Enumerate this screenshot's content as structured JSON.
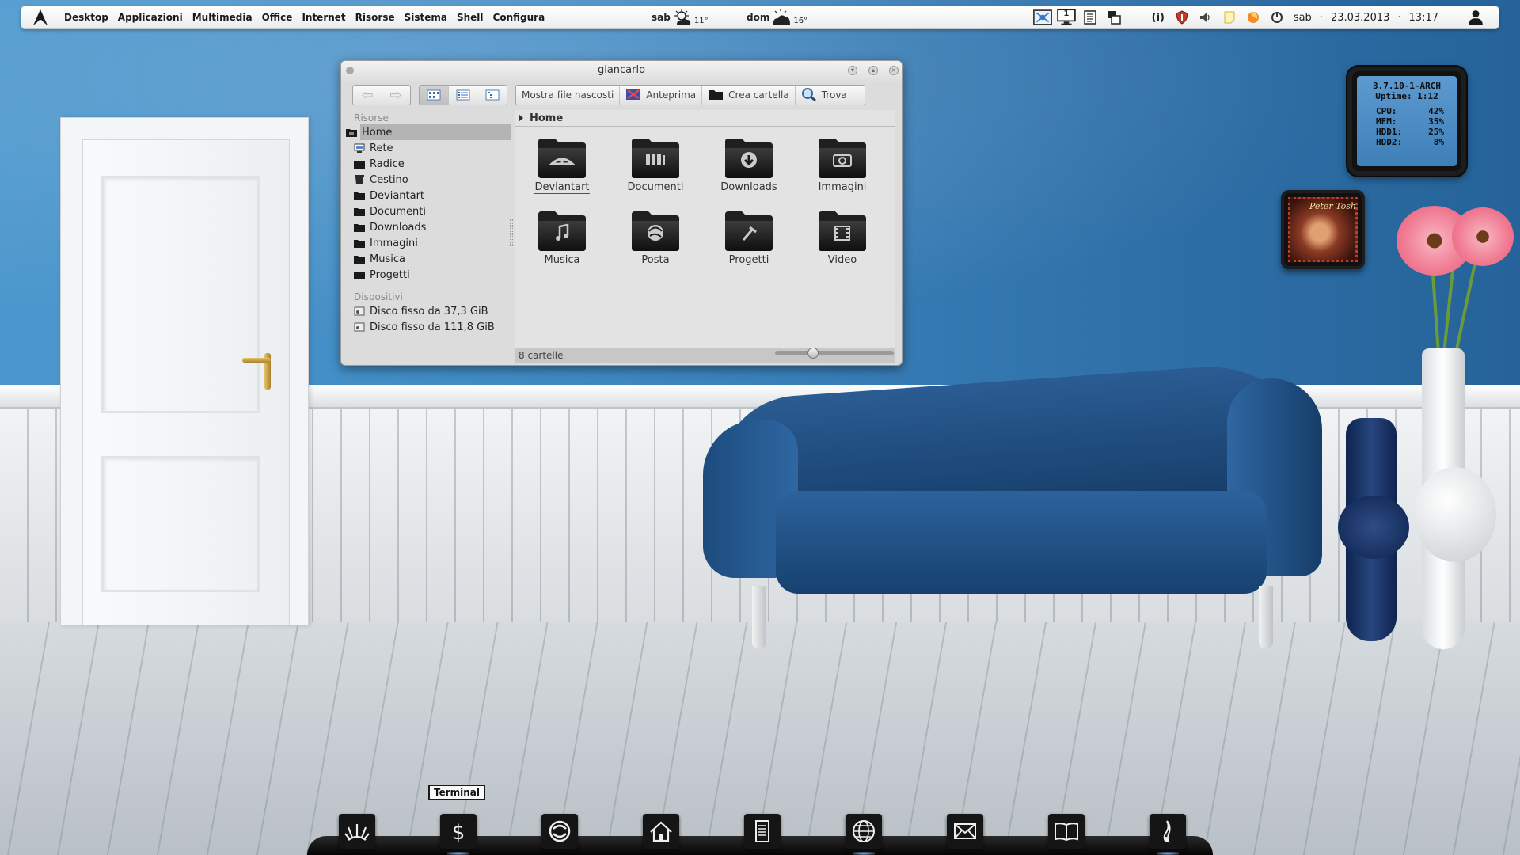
{
  "top_panel": {
    "launcher_icon": "arch-logo-icon",
    "menu": [
      "Desktop",
      "Applicazioni",
      "Multimedia",
      "Office",
      "Internet",
      "Risorse",
      "Sistema",
      "Shell",
      "Configura"
    ],
    "weather": [
      {
        "day": "sab",
        "temp": "11°",
        "icon": "partly-cloudy-icon"
      },
      {
        "day": "dom",
        "temp": "16°",
        "icon": "cloudy-icon"
      }
    ],
    "tray_icons": [
      "screenshot-icon",
      "workspace-icon",
      "clipboard-icon",
      "windows-icon",
      "info-icon",
      "shield-icon",
      "volume-icon",
      "note-icon",
      "firefox-icon",
      "power-icon"
    ],
    "tray_workspace_number": "1",
    "tray_info_label": "(i)",
    "clock_day": "sab",
    "separator": "·",
    "clock_date": "23.03.2013",
    "clock_time": "13:17",
    "user_icon": "user-icon"
  },
  "file_manager": {
    "title": "giancarlo",
    "toolbar": {
      "back_icon": "back-arrow-icon",
      "forward_icon": "forward-arrow-icon",
      "view_modes": [
        "icon-view-icon",
        "list-view-icon",
        "tree-view-icon"
      ],
      "show_hidden": "Mostra file nascosti",
      "preview": "Anteprima",
      "create_folder": "Crea cartella",
      "find": "Trova"
    },
    "sidebar": {
      "resources_header": "Risorse",
      "resources": [
        {
          "label": "Home",
          "icon": "home-folder-icon",
          "active": true
        },
        {
          "label": "Rete",
          "icon": "network-icon"
        },
        {
          "label": "Radice",
          "icon": "folder-icon"
        },
        {
          "label": "Cestino",
          "icon": "trash-icon"
        },
        {
          "label": "Deviantart",
          "icon": "folder-icon"
        },
        {
          "label": "Documenti",
          "icon": "folder-icon"
        },
        {
          "label": "Downloads",
          "icon": "folder-icon"
        },
        {
          "label": "Immagini",
          "icon": "folder-icon"
        },
        {
          "label": "Musica",
          "icon": "folder-icon"
        },
        {
          "label": "Progetti",
          "icon": "folder-icon"
        }
      ],
      "devices_header": "Dispositivi",
      "devices": [
        {
          "label": "Disco fisso da 37,3 GiB",
          "icon": "hard-disk-icon"
        },
        {
          "label": "Disco fisso da 111,8 GiB",
          "icon": "hard-disk-icon"
        }
      ]
    },
    "breadcrumb": "Home",
    "folders": [
      {
        "label": "Deviantart",
        "icon": "deviantart-folder-icon",
        "selected": true
      },
      {
        "label": "Documenti",
        "icon": "documents-folder-icon"
      },
      {
        "label": "Downloads",
        "icon": "downloads-folder-icon"
      },
      {
        "label": "Immagini",
        "icon": "pictures-folder-icon"
      },
      {
        "label": "Musica",
        "icon": "music-folder-icon"
      },
      {
        "label": "Posta",
        "icon": "mail-folder-icon"
      },
      {
        "label": "Progetti",
        "icon": "projects-folder-icon"
      },
      {
        "label": "Video",
        "icon": "video-folder-icon"
      }
    ],
    "status": "8 cartelle",
    "zoom_level": 0.3
  },
  "sysmon": {
    "kernel": "3.7.10-1-ARCH",
    "uptime_label": "Uptime:",
    "uptime": "1:12",
    "rows": [
      {
        "label": "CPU:",
        "value": "42%"
      },
      {
        "label": "MEM:",
        "value": "35%"
      },
      {
        "label": "HDD1:",
        "value": "25%"
      },
      {
        "label": "HDD2:",
        "value": "8%"
      }
    ]
  },
  "album": {
    "title": "Peter Tosh"
  },
  "dock": {
    "tooltip": "Terminal",
    "items": [
      "applications-icon",
      "terminal-icon",
      "system-settings-icon",
      "home-icon",
      "text-editor-icon",
      "web-browser-icon",
      "mail-icon",
      "ebook-reader-icon",
      "music-player-icon"
    ],
    "running": [
      1,
      5,
      8
    ]
  },
  "colors": {
    "wall_blue": "#3e88c2",
    "sofa_blue": "#1f4f85",
    "panel_bg": "#f1f1f1",
    "window_bg": "#dcdcdc"
  }
}
